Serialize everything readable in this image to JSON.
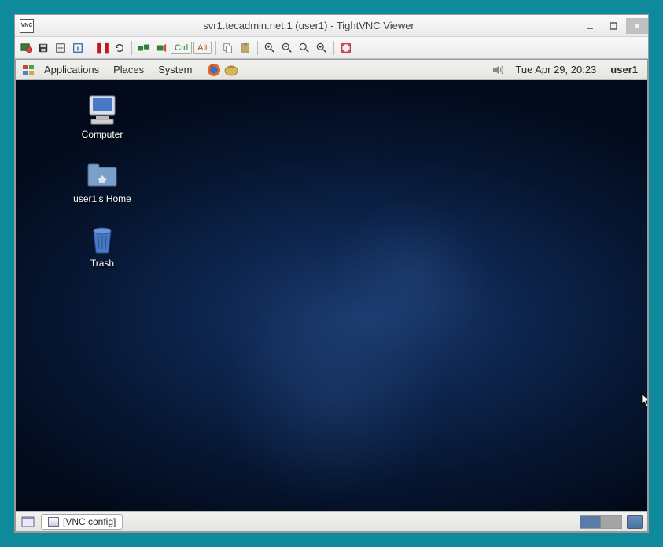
{
  "window": {
    "title": "svr1.tecadmin.net:1 (user1) - TightVNC Viewer",
    "icon_text": "VNC"
  },
  "vnc_toolbar": {
    "ctrl_label": "Ctrl",
    "alt_label": "Alt"
  },
  "gnome": {
    "menus": {
      "applications": "Applications",
      "places": "Places",
      "system": "System"
    },
    "clock": "Tue Apr 29, 20:23",
    "username": "user1"
  },
  "desktop_icons": {
    "computer": "Computer",
    "home": "user1's Home",
    "trash": "Trash"
  },
  "taskbar": {
    "vnc_config": "[VNC config]"
  }
}
